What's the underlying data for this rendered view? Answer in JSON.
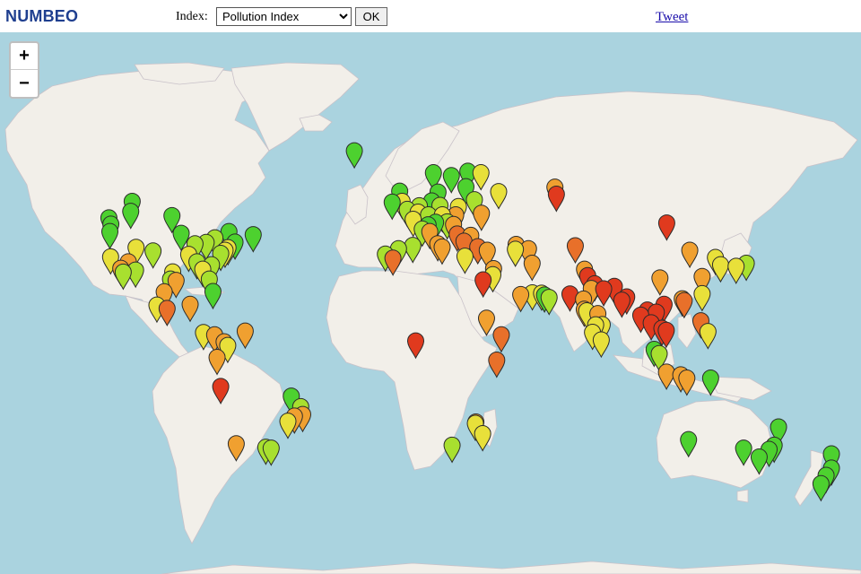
{
  "header": {
    "logo": "NUMBEO",
    "index_label": "Index:",
    "index_selected": "Pollution Index",
    "ok_label": "OK",
    "tweet_label": "Tweet"
  },
  "map": {
    "zoom_in_label": "+",
    "zoom_out_label": "−",
    "colors": {
      "water": "#aad3df",
      "land": "#f2efe9",
      "border": "#b9a8b9",
      "marker_green": "#4dd12f",
      "marker_yellowgreen": "#a8e02f",
      "marker_yellow": "#e8e03a",
      "marker_orange": "#f0a030",
      "marker_darkorange": "#e8702a",
      "marker_red": "#e03a1e"
    },
    "markers": [
      {
        "lon": -122.4,
        "lat": 37.8,
        "level": "yellow"
      },
      {
        "lon": -118.2,
        "lat": 34.0,
        "level": "orange"
      },
      {
        "lon": -117.2,
        "lat": 32.7,
        "level": "yellowgreen"
      },
      {
        "lon": -123.1,
        "lat": 49.3,
        "level": "green"
      },
      {
        "lon": -122.3,
        "lat": 47.6,
        "level": "green"
      },
      {
        "lon": -122.7,
        "lat": 45.5,
        "level": "green"
      },
      {
        "lon": -114.1,
        "lat": 51.0,
        "level": "green"
      },
      {
        "lon": -113.5,
        "lat": 53.5,
        "level": "green"
      },
      {
        "lon": -112.1,
        "lat": 33.4,
        "level": "yellowgreen"
      },
      {
        "lon": -115.1,
        "lat": 36.2,
        "level": "orange"
      },
      {
        "lon": -111.9,
        "lat": 40.8,
        "level": "yellow"
      },
      {
        "lon": -104.9,
        "lat": 39.7,
        "level": "yellowgreen"
      },
      {
        "lon": -97.7,
        "lat": 30.3,
        "level": "yellowgreen"
      },
      {
        "lon": -95.4,
        "lat": 29.8,
        "level": "orange"
      },
      {
        "lon": -96.8,
        "lat": 32.8,
        "level": "yellow"
      },
      {
        "lon": -93.3,
        "lat": 45.0,
        "level": "green"
      },
      {
        "lon": -97.1,
        "lat": 49.9,
        "level": "green"
      },
      {
        "lon": -87.6,
        "lat": 41.9,
        "level": "yellowgreen"
      },
      {
        "lon": -90.2,
        "lat": 38.6,
        "level": "yellow"
      },
      {
        "lon": -83.0,
        "lat": 42.3,
        "level": "yellowgreen"
      },
      {
        "lon": -79.4,
        "lat": 43.7,
        "level": "yellowgreen"
      },
      {
        "lon": -73.6,
        "lat": 45.5,
        "level": "green"
      },
      {
        "lon": -74.0,
        "lat": 40.7,
        "level": "yellow"
      },
      {
        "lon": -71.1,
        "lat": 42.4,
        "level": "green"
      },
      {
        "lon": -77.0,
        "lat": 38.9,
        "level": "yellowgreen"
      },
      {
        "lon": -75.2,
        "lat": 39.9,
        "level": "yellow"
      },
      {
        "lon": -80.8,
        "lat": 35.2,
        "level": "yellowgreen"
      },
      {
        "lon": -84.4,
        "lat": 33.7,
        "level": "yellow"
      },
      {
        "lon": -81.7,
        "lat": 30.3,
        "level": "yellowgreen"
      },
      {
        "lon": -80.2,
        "lat": 25.8,
        "level": "green"
      },
      {
        "lon": -86.8,
        "lat": 36.2,
        "level": "yellowgreen"
      },
      {
        "lon": -63.6,
        "lat": 44.6,
        "level": "green"
      },
      {
        "lon": -99.1,
        "lat": 19.4,
        "level": "darkorange"
      },
      {
        "lon": -103.3,
        "lat": 20.7,
        "level": "yellow"
      },
      {
        "lon": -100.3,
        "lat": 25.7,
        "level": "orange"
      },
      {
        "lon": -89.6,
        "lat": 21.0,
        "level": "orange"
      },
      {
        "lon": -84.1,
        "lat": 9.9,
        "level": "yellow"
      },
      {
        "lon": -79.5,
        "lat": 9.0,
        "level": "orange"
      },
      {
        "lon": -74.1,
        "lat": 4.7,
        "level": "yellow"
      },
      {
        "lon": -75.6,
        "lat": 6.2,
        "level": "orange"
      },
      {
        "lon": -66.9,
        "lat": 10.5,
        "level": "orange"
      },
      {
        "lon": -78.5,
        "lat": -0.2,
        "level": "orange"
      },
      {
        "lon": -77.0,
        "lat": -12.0,
        "level": "red"
      },
      {
        "lon": -70.6,
        "lat": -33.4,
        "level": "orange"
      },
      {
        "lon": -58.4,
        "lat": -34.6,
        "level": "yellowgreen"
      },
      {
        "lon": -56.2,
        "lat": -34.9,
        "level": "yellowgreen"
      },
      {
        "lon": -46.6,
        "lat": -23.5,
        "level": "orange"
      },
      {
        "lon": -43.2,
        "lat": -22.9,
        "level": "orange"
      },
      {
        "lon": -47.9,
        "lat": -15.8,
        "level": "green"
      },
      {
        "lon": -49.3,
        "lat": -25.4,
        "level": "yellow"
      },
      {
        "lon": -44.0,
        "lat": -19.9,
        "level": "yellowgreen"
      },
      {
        "lon": -21.9,
        "lat": 64.1,
        "level": "green"
      },
      {
        "lon": -0.1,
        "lat": 51.5,
        "level": "yellowgreen"
      },
      {
        "lon": -2.2,
        "lat": 53.5,
        "level": "yellow"
      },
      {
        "lon": -6.3,
        "lat": 53.3,
        "level": "green"
      },
      {
        "lon": -3.2,
        "lat": 55.9,
        "level": "green"
      },
      {
        "lon": 2.35,
        "lat": 48.9,
        "level": "yellow"
      },
      {
        "lon": 4.9,
        "lat": 52.4,
        "level": "yellowgreen"
      },
      {
        "lon": 4.4,
        "lat": 50.8,
        "level": "yellow"
      },
      {
        "lon": 8.7,
        "lat": 50.1,
        "level": "yellowgreen"
      },
      {
        "lon": 13.4,
        "lat": 52.5,
        "level": "yellowgreen"
      },
      {
        "lon": 11.6,
        "lat": 48.1,
        "level": "green"
      },
      {
        "lon": 10.0,
        "lat": 53.6,
        "level": "green"
      },
      {
        "lon": 12.6,
        "lat": 55.7,
        "level": "green"
      },
      {
        "lon": 10.7,
        "lat": 59.9,
        "level": "green"
      },
      {
        "lon": 18.1,
        "lat": 59.3,
        "level": "green"
      },
      {
        "lon": 24.9,
        "lat": 60.2,
        "level": "green"
      },
      {
        "lon": 21.0,
        "lat": 52.2,
        "level": "yellow"
      },
      {
        "lon": 19.9,
        "lat": 50.1,
        "level": "orange"
      },
      {
        "lon": 14.4,
        "lat": 50.1,
        "level": "yellow"
      },
      {
        "lon": 16.4,
        "lat": 48.2,
        "level": "yellowgreen"
      },
      {
        "lon": 19.0,
        "lat": 47.5,
        "level": "orange"
      },
      {
        "lon": 8.5,
        "lat": 47.4,
        "level": "green"
      },
      {
        "lon": 6.1,
        "lat": 46.2,
        "level": "yellowgreen"
      },
      {
        "lon": 9.2,
        "lat": 45.5,
        "level": "orange"
      },
      {
        "lon": 12.5,
        "lat": 41.9,
        "level": "orange"
      },
      {
        "lon": 14.3,
        "lat": 40.9,
        "level": "orange"
      },
      {
        "lon": -3.7,
        "lat": 40.4,
        "level": "yellowgreen"
      },
      {
        "lon": 2.2,
        "lat": 41.4,
        "level": "yellowgreen"
      },
      {
        "lon": -9.1,
        "lat": 38.7,
        "level": "yellowgreen"
      },
      {
        "lon": -5.99,
        "lat": 37.4,
        "level": "darkorange"
      },
      {
        "lon": 26.1,
        "lat": 44.4,
        "level": "orange"
      },
      {
        "lon": 23.3,
        "lat": 42.7,
        "level": "darkorange"
      },
      {
        "lon": 20.5,
        "lat": 44.8,
        "level": "darkorange"
      },
      {
        "lon": 23.7,
        "lat": 38.0,
        "level": "yellow"
      },
      {
        "lon": 29.0,
        "lat": 41.0,
        "level": "darkorange"
      },
      {
        "lon": 30.5,
        "lat": 50.5,
        "level": "orange"
      },
      {
        "lon": 27.6,
        "lat": 53.9,
        "level": "yellowgreen"
      },
      {
        "lon": 24.1,
        "lat": 56.9,
        "level": "green"
      },
      {
        "lon": 37.6,
        "lat": 55.8,
        "level": "yellow"
      },
      {
        "lon": 30.3,
        "lat": 59.9,
        "level": "yellow"
      },
      {
        "lon": 32.9,
        "lat": 39.9,
        "level": "orange"
      },
      {
        "lon": 44.5,
        "lat": 40.2,
        "level": "yellow"
      },
      {
        "lon": 44.8,
        "lat": 41.7,
        "level": "orange"
      },
      {
        "lon": 49.9,
        "lat": 40.4,
        "level": "orange"
      },
      {
        "lon": 35.5,
        "lat": 33.9,
        "level": "orange"
      },
      {
        "lon": 35.2,
        "lat": 31.8,
        "level": "yellow"
      },
      {
        "lon": 31.2,
        "lat": 30.0,
        "level": "red"
      },
      {
        "lon": 46.7,
        "lat": 24.7,
        "level": "orange"
      },
      {
        "lon": 51.5,
        "lat": 25.3,
        "level": "yellow"
      },
      {
        "lon": 55.3,
        "lat": 25.2,
        "level": "yellow"
      },
      {
        "lon": 58.4,
        "lat": 23.6,
        "level": "yellowgreen"
      },
      {
        "lon": 56.5,
        "lat": 24.5,
        "level": "green"
      },
      {
        "lon": 51.4,
        "lat": 35.7,
        "level": "orange"
      },
      {
        "lon": 60.8,
        "lat": 56.8,
        "level": "orange"
      },
      {
        "lon": 61.4,
        "lat": 55.2,
        "level": "red"
      },
      {
        "lon": 69.2,
        "lat": 41.3,
        "level": "darkorange"
      },
      {
        "lon": 67.0,
        "lat": 24.9,
        "level": "red"
      },
      {
        "lon": 74.3,
        "lat": 31.5,
        "level": "red"
      },
      {
        "lon": 73.0,
        "lat": 33.7,
        "level": "orange"
      },
      {
        "lon": 77.2,
        "lat": 28.6,
        "level": "red"
      },
      {
        "lon": 75.8,
        "lat": 26.9,
        "level": "orange"
      },
      {
        "lon": 72.6,
        "lat": 23.0,
        "level": "orange"
      },
      {
        "lon": 72.9,
        "lat": 19.1,
        "level": "orange"
      },
      {
        "lon": 73.9,
        "lat": 18.5,
        "level": "yellow"
      },
      {
        "lon": 77.6,
        "lat": 13.0,
        "level": "yellow"
      },
      {
        "lon": 78.5,
        "lat": 17.4,
        "level": "orange"
      },
      {
        "lon": 80.3,
        "lat": 13.1,
        "level": "yellow"
      },
      {
        "lon": 76.3,
        "lat": 10.0,
        "level": "yellow"
      },
      {
        "lon": 80.9,
        "lat": 26.8,
        "level": "red"
      },
      {
        "lon": 85.3,
        "lat": 27.7,
        "level": "red"
      },
      {
        "lon": 88.4,
        "lat": 22.6,
        "level": "red"
      },
      {
        "lon": 90.4,
        "lat": 23.8,
        "level": "red"
      },
      {
        "lon": 79.9,
        "lat": 6.9,
        "level": "yellow"
      },
      {
        "lon": 96.2,
        "lat": 16.8,
        "level": "red"
      },
      {
        "lon": 100.5,
        "lat": 13.8,
        "level": "red"
      },
      {
        "lon": 98.9,
        "lat": 18.8,
        "level": "red"
      },
      {
        "lon": 102.6,
        "lat": 18.0,
        "level": "red"
      },
      {
        "lon": 105.8,
        "lat": 21.0,
        "level": "red"
      },
      {
        "lon": 106.7,
        "lat": 10.8,
        "level": "red"
      },
      {
        "lon": 104.9,
        "lat": 11.6,
        "level": "red"
      },
      {
        "lon": 101.7,
        "lat": 3.1,
        "level": "green"
      },
      {
        "lon": 103.8,
        "lat": 1.35,
        "level": "yellowgreen"
      },
      {
        "lon": 106.8,
        "lat": -6.2,
        "level": "orange"
      },
      {
        "lon": 112.7,
        "lat": -7.3,
        "level": "orange"
      },
      {
        "lon": 115.2,
        "lat": -8.6,
        "level": "orange"
      },
      {
        "lon": 120.98,
        "lat": 14.6,
        "level": "darkorange"
      },
      {
        "lon": 123.9,
        "lat": 10.3,
        "level": "yellow"
      },
      {
        "lon": 121.5,
        "lat": 25.0,
        "level": "yellow"
      },
      {
        "lon": 114.1,
        "lat": 22.4,
        "level": "darkorange"
      },
      {
        "lon": 113.3,
        "lat": 23.1,
        "level": "orange"
      },
      {
        "lon": 121.5,
        "lat": 31.2,
        "level": "orange"
      },
      {
        "lon": 116.4,
        "lat": 39.9,
        "level": "orange"
      },
      {
        "lon": 104.1,
        "lat": 30.7,
        "level": "orange"
      },
      {
        "lon": 106.9,
        "lat": 47.9,
        "level": "red"
      },
      {
        "lon": 126.98,
        "lat": 37.6,
        "level": "yellow"
      },
      {
        "lon": 129.1,
        "lat": 35.2,
        "level": "yellow"
      },
      {
        "lon": 139.7,
        "lat": 35.7,
        "level": "yellowgreen"
      },
      {
        "lon": 135.5,
        "lat": 34.7,
        "level": "yellow"
      },
      {
        "lon": 125.0,
        "lat": -8.6,
        "level": "green"
      },
      {
        "lon": 3.4,
        "lat": 6.5,
        "level": "red"
      },
      {
        "lon": 36.8,
        "lat": -1.3,
        "level": "darkorange"
      },
      {
        "lon": 38.7,
        "lat": 9.0,
        "level": "darkorange"
      },
      {
        "lon": 32.6,
        "lat": 15.6,
        "level": "orange"
      },
      {
        "lon": 28.0,
        "lat": -26.2,
        "level": "yellow"
      },
      {
        "lon": 31.0,
        "lat": -29.9,
        "level": "yellow"
      },
      {
        "lon": 28.2,
        "lat": -25.7,
        "level": "orange"
      },
      {
        "lon": 18.4,
        "lat": -33.9,
        "level": "yellowgreen"
      },
      {
        "lon": 115.9,
        "lat": -32.0,
        "level": "green"
      },
      {
        "lon": 138.6,
        "lat": -34.9,
        "level": "green"
      },
      {
        "lon": 145.0,
        "lat": -37.8,
        "level": "green"
      },
      {
        "lon": 149.1,
        "lat": -35.3,
        "level": "green"
      },
      {
        "lon": 151.2,
        "lat": -33.9,
        "level": "green"
      },
      {
        "lon": 153.0,
        "lat": -27.5,
        "level": "green"
      },
      {
        "lon": 174.8,
        "lat": -36.8,
        "level": "green"
      },
      {
        "lon": 172.6,
        "lat": -43.5,
        "level": "green"
      },
      {
        "lon": 174.8,
        "lat": -41.3,
        "level": "green"
      },
      {
        "lon": 170.5,
        "lat": -45.9,
        "level": "green"
      }
    ]
  }
}
